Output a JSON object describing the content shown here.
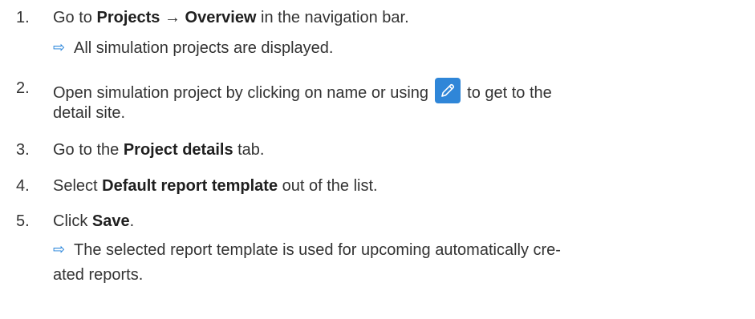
{
  "colors": {
    "text": "#333333",
    "arrow": "#1a7cd8",
    "edit_icon_bg": "#2f86d8"
  },
  "steps": [
    {
      "number": "1.",
      "parts": [
        "Go to ",
        "Projects",
        " → ",
        "Overview",
        " in the navigation bar."
      ],
      "result": "All simulation projects are displayed."
    },
    {
      "number": "2.",
      "parts": [
        "Open simulation project by clicking on name or using ",
        " to get to the"
      ],
      "line2": "detail site.",
      "icon": "pencil-edit-icon"
    },
    {
      "number": "3.",
      "parts": [
        "Go to the ",
        "Project details",
        " tab."
      ]
    },
    {
      "number": "4.",
      "parts": [
        "Select ",
        "Default report template",
        " out of the list."
      ]
    },
    {
      "number": "5.",
      "parts": [
        "Click ",
        "Save",
        "."
      ],
      "result_line1": "The selected report template is used for upcoming automatically cre-",
      "result_line2": "ated reports."
    }
  ],
  "result_arrow": "⇨"
}
